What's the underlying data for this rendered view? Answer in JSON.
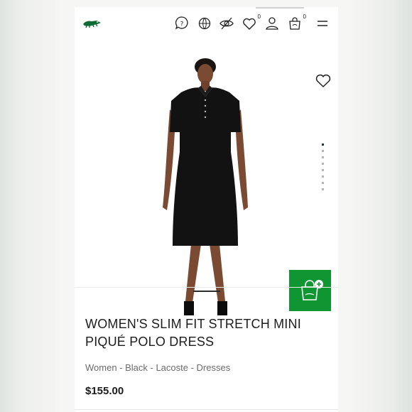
{
  "colors": {
    "brand_green": "#0f9632",
    "text": "#1c1c1c",
    "muted": "#6b6b6b"
  },
  "header": {
    "logo": "crocodile-logo",
    "icons": [
      "help-icon",
      "language-icon",
      "hide-icon",
      "wishlist-icon",
      "account-icon",
      "bag-icon",
      "menu-icon"
    ],
    "wishlist_count": "0",
    "bag_count": "0"
  },
  "gallery": {
    "image": "model-in-black-polo-dress",
    "slide_count": 8,
    "active_slide": 1,
    "add_to_bag_icon": "add-to-bag-icon"
  },
  "product": {
    "title_line1": "WOMEN'S SLIM FIT STRETCH MINI",
    "title_line2": "PIQUÉ POLO DRESS",
    "breadcrumbs": "Women - Black - Lacoste - Dresses",
    "price": "$155.00"
  }
}
